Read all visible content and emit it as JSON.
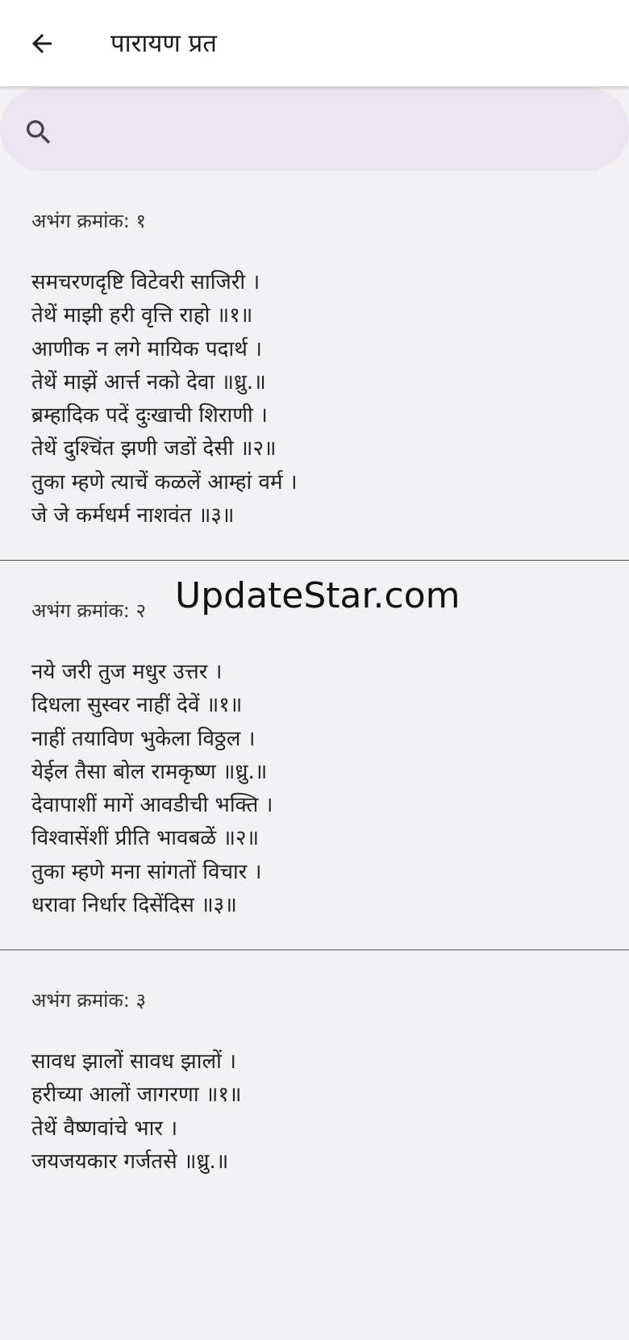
{
  "appbar": {
    "title": "पारायण प्रत",
    "back_icon": "arrow-left-icon"
  },
  "search": {
    "icon": "search-icon",
    "placeholder": "",
    "value": ""
  },
  "abhangs": [
    {
      "heading": "अभंग क्रमांक: १",
      "lines": [
        "समचरणदृष्टि विटेवरी साजिरी ।",
        "तेथें माझी हरी वृत्ति राहो ॥१॥",
        "आणीक न लगे मायिक पदार्थ ।",
        "तेथें माझें आर्त्त नको देवा ॥ध्रु.॥",
        "ब्रम्हादिक पदें दुःखाची शिराणी ।",
        "तेथें दुश्चिंत झणी जडों देसी ॥२॥",
        "तुका म्हणे त्याचें कळलें आम्हां वर्म ।",
        "जे जे कर्मधर्म नाशवंत ॥३॥"
      ]
    },
    {
      "heading": "अभंग क्रमांक: २",
      "lines": [
        "नये जरी तुज मधुर उत्तर ।",
        "दिधला सुस्वर नाहीं देवें ॥१॥",
        "नाहीं तयाविण भुकेला विठ्ठल ।",
        "येईल तैसा बोल रामकृष्ण ॥ध्रु.॥",
        "देवापाशीं मागें आवडीची भक्ति ।",
        "विश्वासेंशीं प्रीति भावबळें ॥२॥",
        "तुका म्हणे मना सांगतों विचार ।",
        "धरावा निर्धार दिसेंदिस ॥३॥"
      ]
    },
    {
      "heading": "अभंग क्रमांक: ३",
      "lines": [
        "सावध झालों सावध झालों ।",
        "हरीच्या आलों जागरणा ॥१॥",
        "तेथें वैष्णवांचे भार ।",
        "जयजयकार गर्जतसे ॥ध्रु.॥"
      ]
    }
  ],
  "watermark": "UpdateStar.com"
}
